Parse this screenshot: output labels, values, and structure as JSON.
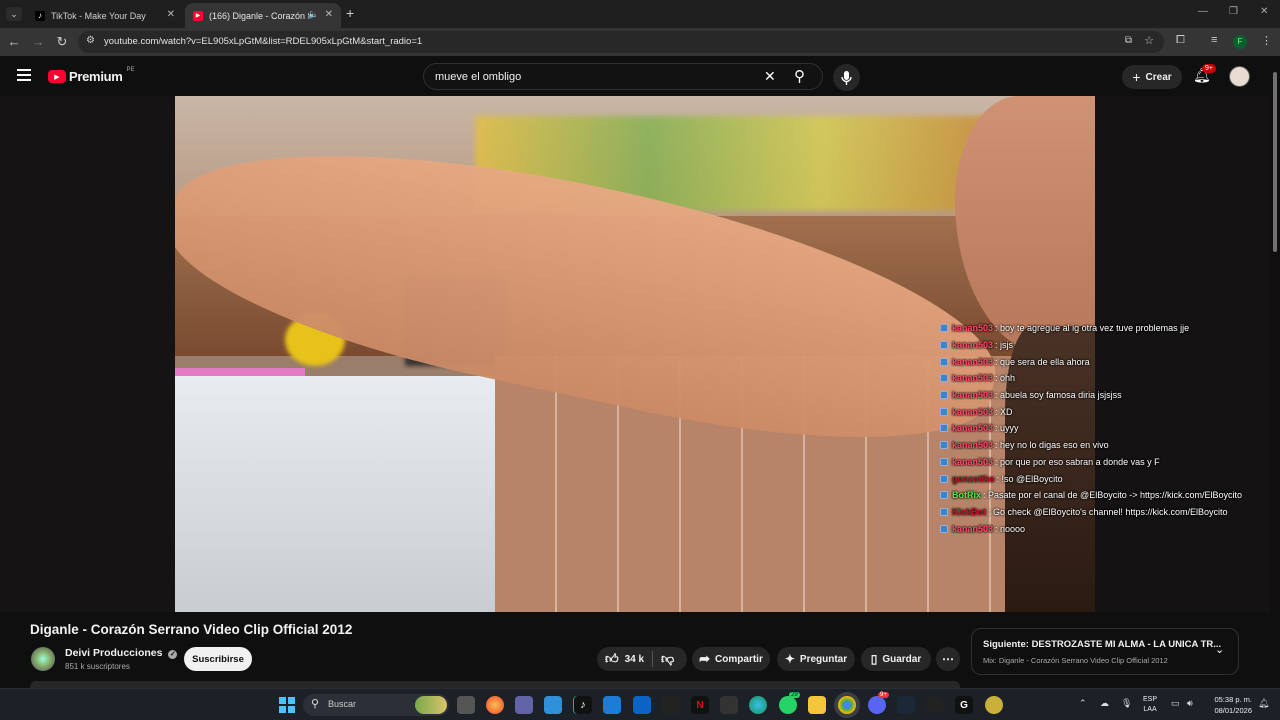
{
  "browser": {
    "tabs": [
      {
        "label": "TikTok - Make Your Day",
        "active": false
      },
      {
        "label": "(166) Diganle - Corazón Se",
        "active": true
      }
    ],
    "url": "youtube.com/watch?v=EL905xLpGtM&list=RDEL905xLpGtM&start_radio=1",
    "profile_initial": "F"
  },
  "header": {
    "logo_text": "Premium",
    "logo_region": "PE",
    "search_query": "mueve el ombligo",
    "create_label": "Crear",
    "notifications_badge": "9+"
  },
  "chat": [
    {
      "user": "kanan503",
      "text": ": boy te agregue al ig otra vez tuve problemas jje",
      "style": "pink"
    },
    {
      "user": "kanan503",
      "text": ": jsjs",
      "style": "pink"
    },
    {
      "user": "kanan503",
      "text": ": que sera de ella ahora",
      "style": "pink"
    },
    {
      "user": "kanan503",
      "text": ": ohh",
      "style": "pink"
    },
    {
      "user": "kanan503",
      "text": ": abuela soy famosa diria jsjsjss",
      "style": "pink"
    },
    {
      "user": "kanan503",
      "text": ": XD",
      "style": "pink"
    },
    {
      "user": "kanan503",
      "text": ": uyyy",
      "style": "pink"
    },
    {
      "user": "kanan503",
      "text": ": hey no lo digas eso en vivo",
      "style": "pink"
    },
    {
      "user": "kanan503",
      "text": ": por que por eso sabran a donde vas y F",
      "style": "pink"
    },
    {
      "user": "gonzotiko",
      "text": ": !so @ElBoycito",
      "style": "red"
    },
    {
      "user": "BotRix",
      "text": ": Pasate por el canal de @ElBoycito -> https://kick.com/ElBoycito",
      "style": "green"
    },
    {
      "user": "KickBot",
      "text": ": Go check @ElBoycito's channel! https://kick.com/ElBoycito",
      "style": "red"
    },
    {
      "user": "kanan503",
      "text": ": noooo",
      "style": "pink"
    }
  ],
  "video": {
    "title": "Diganle - Corazón Serrano Video Clip Official 2012",
    "channel": "Deivi Producciones",
    "subscribers": "851 k suscriptores",
    "subscribe_label": "Suscribirse",
    "likes": "34 k",
    "share_label": "Compartir",
    "ask_label": "Preguntar",
    "save_label": "Guardar"
  },
  "up_next": {
    "prefix": "Siguiente:",
    "title": "DESTROZASTE MI ALMA - LA UNICA TR...",
    "subtitle": "Mix: Diganle - Corazón Serrano Video Clip Official 2012"
  },
  "taskbar": {
    "search_label": "Buscar",
    "language": "ESP",
    "layout": "LAA",
    "time": "05:38 p. m.",
    "date": "08/01/2026",
    "discord_badge": "9+",
    "whatsapp_badge": "29"
  },
  "colors": {
    "accent_red": "#ff0033",
    "chat_user": "#ff4a6a",
    "chat_bot": "#52e84b"
  }
}
